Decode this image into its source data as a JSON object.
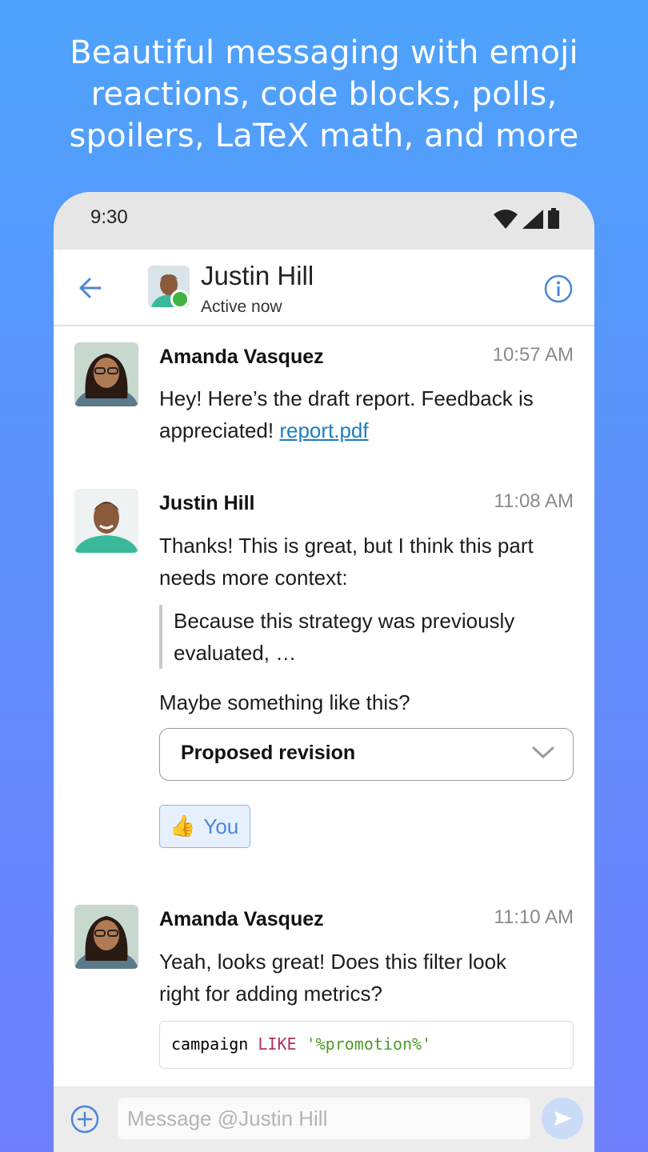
{
  "headline": {
    "line1": "Beautiful messaging with emoji",
    "line2": "reactions, code blocks, polls,",
    "line3": "spoilers, LaTeX math, and more"
  },
  "status_bar": {
    "time": "9:30"
  },
  "chat_header": {
    "name": "Justin Hill",
    "status": "Active now"
  },
  "messages": [
    {
      "sender": "Amanda Vasquez",
      "time": "10:57 AM",
      "text_line1": "Hey! Here’s the draft report. Feedback is",
      "text_line2": "appreciated! ",
      "link": "report.pdf"
    },
    {
      "sender": "Justin Hill",
      "time": "11:08 AM",
      "text_line1": "Thanks! This is great, but I think this part",
      "text_line2": "needs more context:",
      "quote_line1": "Because this strategy was previously",
      "quote_line2": "evaluated, …",
      "followup": "Maybe something like this?",
      "spoiler_label": "Proposed revision",
      "reaction_emoji": "👍",
      "reaction_label": "You"
    },
    {
      "sender": "Amanda Vasquez",
      "time": "11:10 AM",
      "text_line1": "Yeah, looks great! Does this filter look",
      "text_line2": "right for adding metrics?",
      "code_ident": "campaign",
      "code_keyword": "LIKE",
      "code_string": "'%promotion%'"
    }
  ],
  "composer": {
    "placeholder": "Message @Justin Hill"
  },
  "colors": {
    "accent": "#4a86d8",
    "online": "#3fb53f",
    "link": "#1a7fc1",
    "code_keyword": "#b0305a",
    "code_string": "#4d9b2a"
  },
  "icons": {
    "back": "arrow-left-icon",
    "info": "info-icon",
    "wifi": "wifi-icon",
    "signal": "signal-icon",
    "battery": "battery-icon",
    "chevron": "chevron-down-icon",
    "add": "plus-circle-icon",
    "send": "send-icon"
  }
}
